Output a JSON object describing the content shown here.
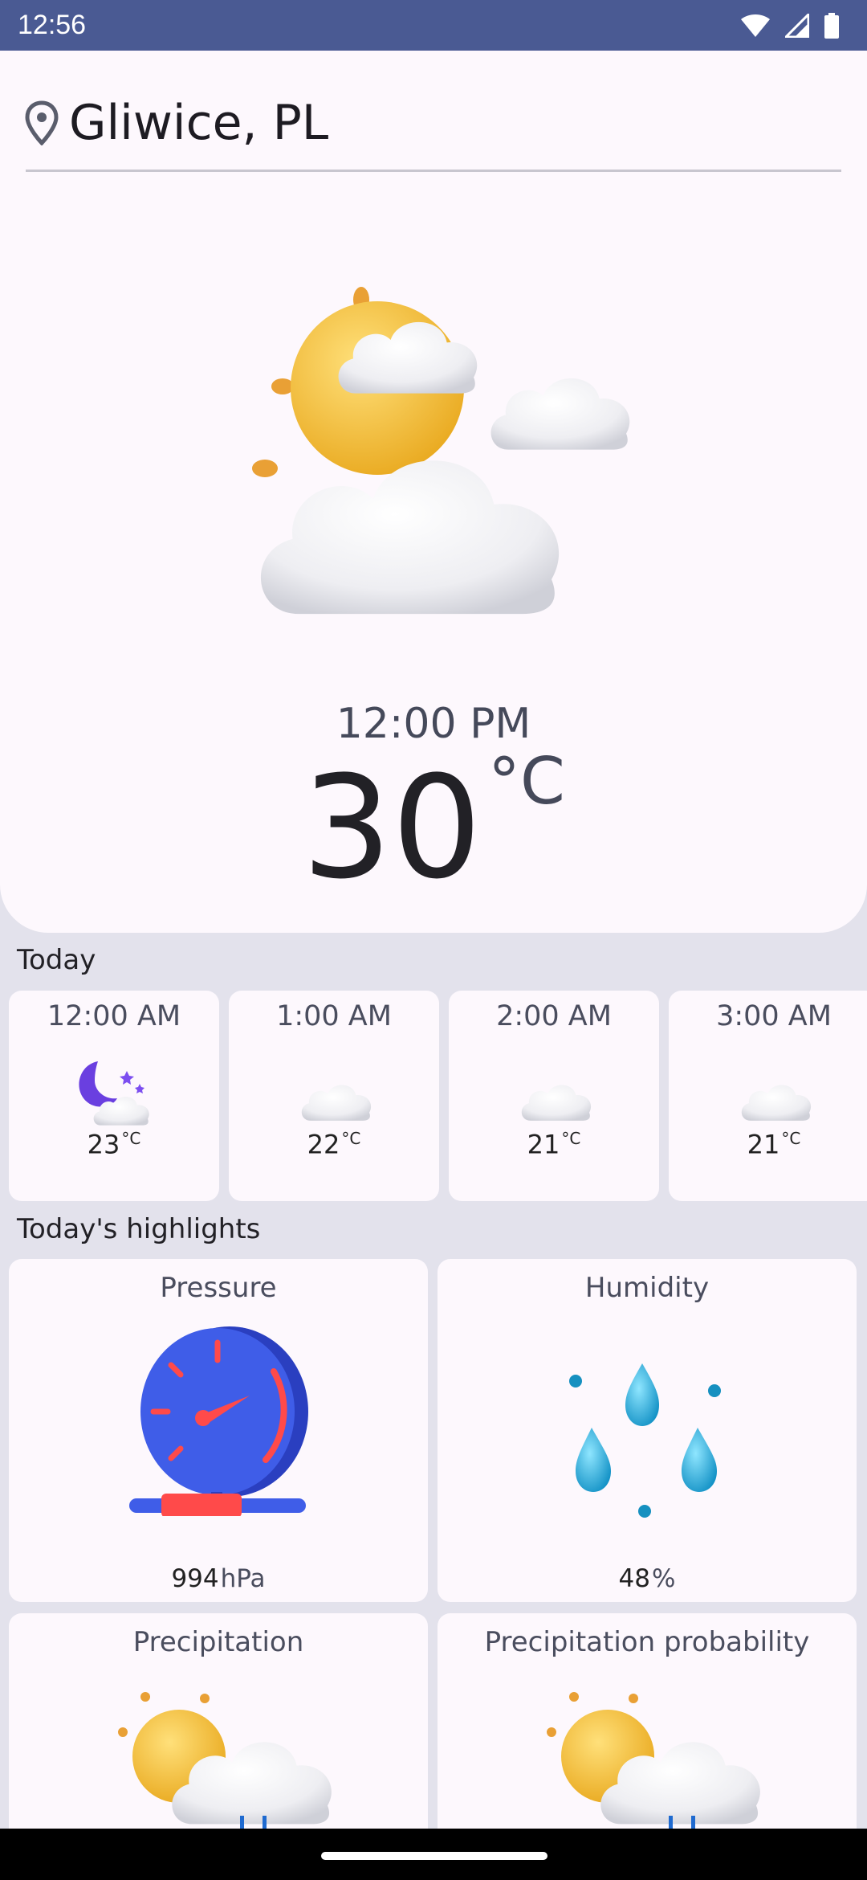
{
  "status_bar": {
    "time": "12:56",
    "icons": [
      "wifi-icon",
      "signal-icon",
      "battery-icon"
    ]
  },
  "location": {
    "name": "Gliwice, PL",
    "icon": "location-pin-icon"
  },
  "current": {
    "time": "12:00 PM",
    "temperature": "30",
    "unit": "°C",
    "icon": "sun-behind-clouds-icon"
  },
  "today": {
    "title": "Today",
    "hours": [
      {
        "time": "12:00 AM",
        "temp": "23",
        "unit": "°C",
        "icon": "moon-cloud-icon"
      },
      {
        "time": "1:00 AM",
        "temp": "22",
        "unit": "°C",
        "icon": "cloud-icon"
      },
      {
        "time": "2:00 AM",
        "temp": "21",
        "unit": "°C",
        "icon": "cloud-icon"
      },
      {
        "time": "3:00 AM",
        "temp": "21",
        "unit": "°C",
        "icon": "cloud-icon"
      }
    ]
  },
  "highlights": {
    "title": "Today's highlights",
    "pressure": {
      "label": "Pressure",
      "value": "994",
      "unit": "hPa",
      "icon": "pressure-gauge-icon"
    },
    "humidity": {
      "label": "Humidity",
      "value": "48",
      "unit": "%",
      "icon": "water-drops-icon"
    },
    "precipitation": {
      "label": "Precipitation",
      "icon": "sun-cloud-rain-icon"
    },
    "precipitation_probability": {
      "label": "Precipitation probability",
      "icon": "sun-cloud-rain-icon"
    }
  },
  "colors": {
    "status_bar": "#4a5a93",
    "background": "#e3e2ec",
    "card": "#fdf8fd",
    "sun": "#f2c23a",
    "gauge": "#3f5de8",
    "drop": "#2bb3e0"
  }
}
